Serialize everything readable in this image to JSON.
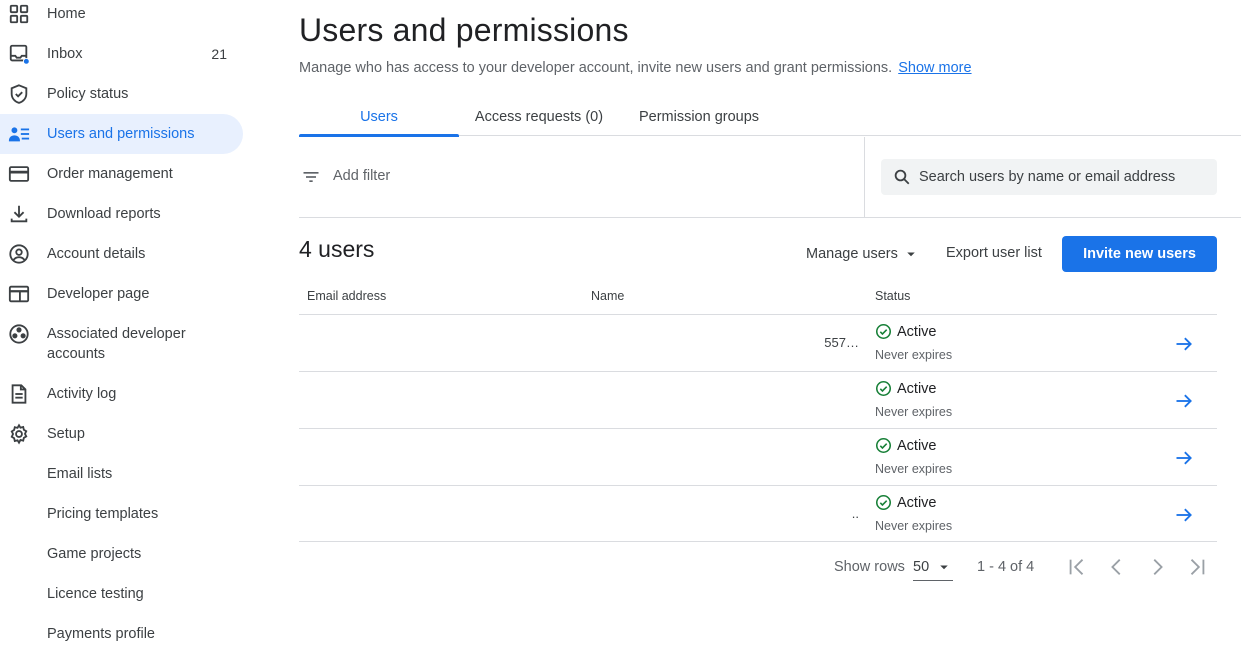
{
  "sidebar": {
    "items": [
      {
        "label": "Home",
        "icon": "grid-icon"
      },
      {
        "label": "Inbox",
        "icon": "inbox-icon",
        "badge": "21"
      },
      {
        "label": "Policy status",
        "icon": "shield-icon"
      },
      {
        "label": "Users and permissions",
        "icon": "users-list-icon",
        "active": true
      },
      {
        "label": "Order management",
        "icon": "credit-card-icon"
      },
      {
        "label": "Download reports",
        "icon": "download-icon"
      },
      {
        "label": "Account details",
        "icon": "account-circle-icon"
      },
      {
        "label": "Developer page",
        "icon": "web-page-icon"
      },
      {
        "label": "Associated developer accounts",
        "icon": "linked-accounts-icon"
      },
      {
        "label": "Activity log",
        "icon": "document-icon"
      },
      {
        "label": "Setup",
        "icon": "gear-icon"
      },
      {
        "label": "Email lists"
      },
      {
        "label": "Pricing templates"
      },
      {
        "label": "Game projects"
      },
      {
        "label": "Licence testing"
      },
      {
        "label": "Payments profile"
      }
    ]
  },
  "header": {
    "title": "Users and permissions",
    "description": "Manage who has access to your developer account, invite new users and grant permissions.",
    "show_more": "Show more"
  },
  "tabs": [
    {
      "label": "Users",
      "active": true
    },
    {
      "label": "Access requests (0)"
    },
    {
      "label": "Permission groups"
    }
  ],
  "filter": {
    "add_filter": "Add filter",
    "search_placeholder": "Search users by name or email address"
  },
  "toolbar": {
    "user_count": "4 users",
    "manage_users": "Manage users",
    "export_user_list": "Export user list",
    "invite_new_users": "Invite new users"
  },
  "table": {
    "columns": [
      "Email address",
      "Name",
      "Status"
    ],
    "rows": [
      {
        "email": "557…",
        "name": "",
        "status": "Active",
        "expires": "Never expires"
      },
      {
        "email": "",
        "name": "",
        "status": "Active",
        "expires": "Never expires"
      },
      {
        "email": "",
        "name": "",
        "status": "Active",
        "expires": "Never expires"
      },
      {
        "email": "..",
        "name": "",
        "status": "Active",
        "expires": "Never expires"
      }
    ]
  },
  "pagination": {
    "show_rows_label": "Show rows",
    "rows_value": "50",
    "range": "1 - 4 of 4"
  },
  "colors": {
    "accent": "#1a73e8",
    "active_nav_bg": "#e8f0fe",
    "status_green": "#188038"
  }
}
